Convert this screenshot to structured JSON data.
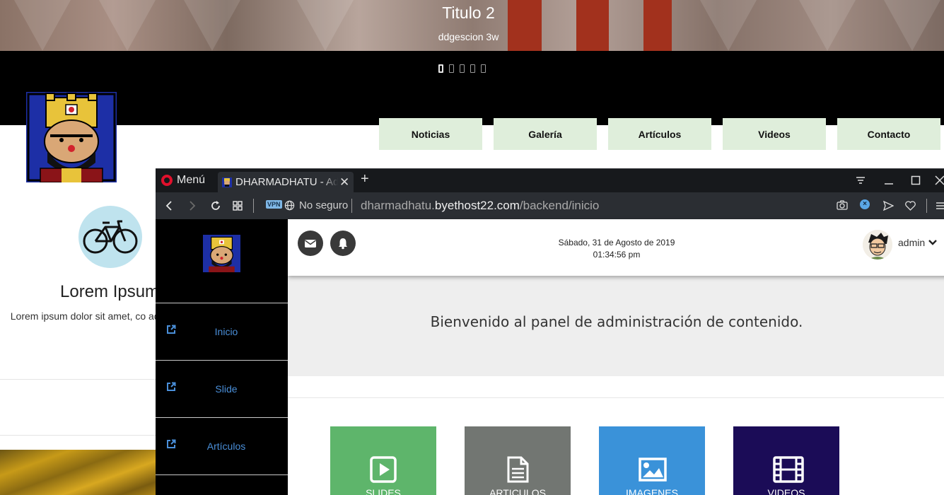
{
  "website": {
    "hero_title": "Titulo 2",
    "hero_subtitle": "ddgescion 3w",
    "nav": [
      "Noticias",
      "Galería",
      "Artículos",
      "Videos",
      "Contacto"
    ],
    "feature": {
      "icon": "bicycle-icon",
      "title": "Lorem Ipsum",
      "text": "Lorem ipsum dolor sit amet, co adipisicing elit"
    }
  },
  "browser": {
    "menu_label": "Menú",
    "tab_title": "DHARMADHATU - Admin",
    "new_tab_label": "+",
    "vpn_label": "VPN",
    "security_label": "No seguro",
    "url_prefix": "dharmadhatu.",
    "url_domain": "byethost22.com",
    "url_path": "/backend/inicio"
  },
  "panel": {
    "date": "Sábado, 31 de Agosto de 2019",
    "time": "01:34:56 pm",
    "username": "admin",
    "welcome": "Bienvenido al panel de administración de contenido.",
    "sidebar_items": [
      "Inicio",
      "Slide",
      "Artículos"
    ],
    "tiles": [
      {
        "label": "SLIDES",
        "color": "#5eb56b",
        "icon": "play-icon"
      },
      {
        "label": "ARTICULOS",
        "color": "#727672",
        "icon": "document-icon"
      },
      {
        "label": "IMAGENES",
        "color": "#3a92d9",
        "icon": "image-icon"
      },
      {
        "label": "VIDEOS",
        "color": "#1b0c57",
        "icon": "film-icon"
      }
    ]
  }
}
